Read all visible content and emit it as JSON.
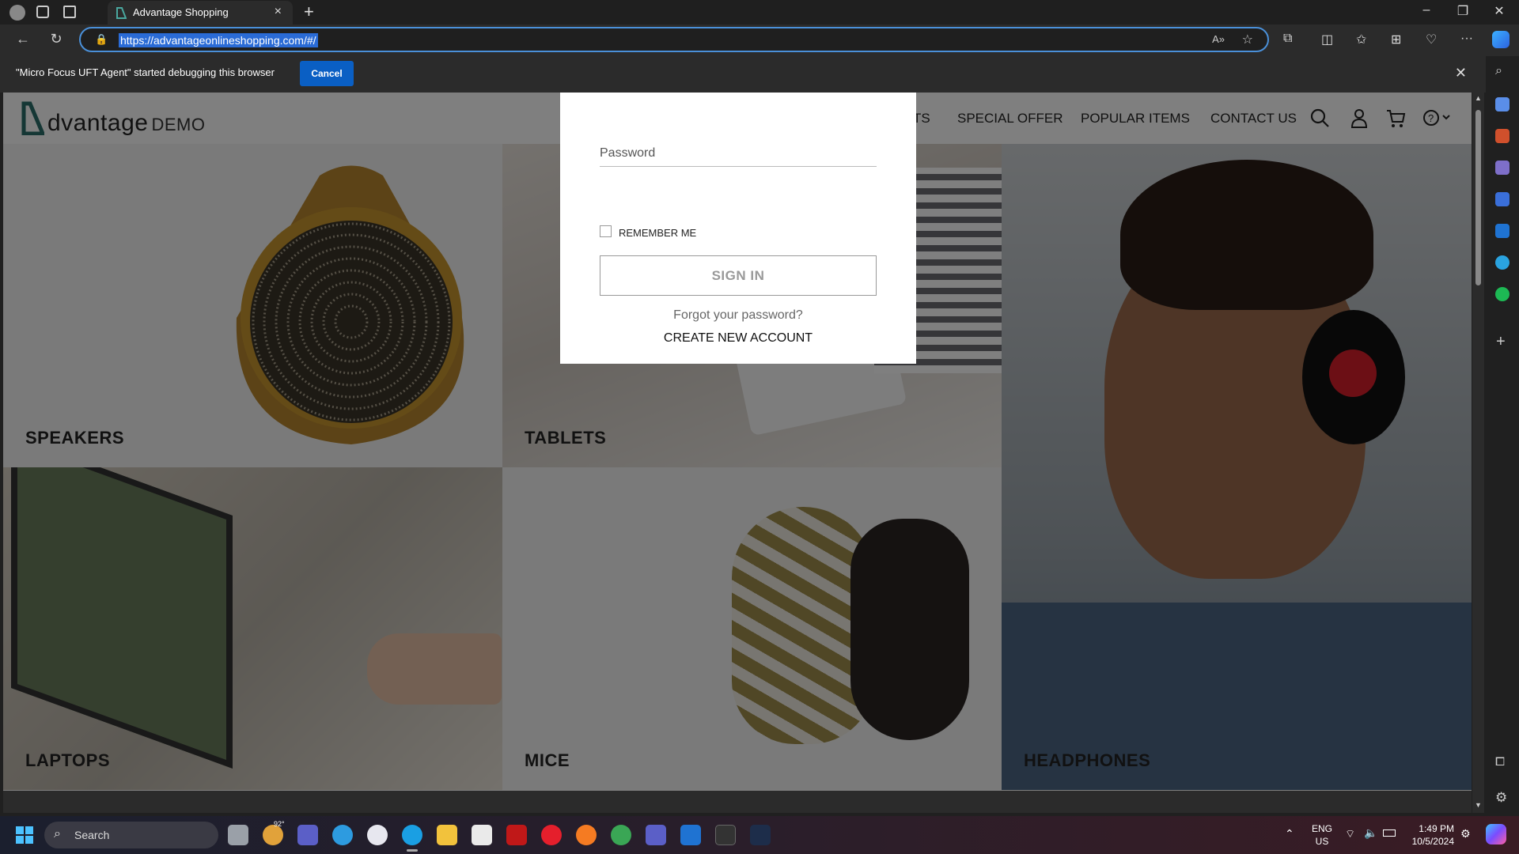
{
  "browser": {
    "tab_title": "Advantage Shopping",
    "tab_close": "×",
    "new_tab": "+",
    "url": "https://advantageonlineshopping.com/#/",
    "window_min": "–",
    "window_restore": "❐",
    "window_close": "✕",
    "more": "···"
  },
  "infobar": {
    "message": "\"Micro Focus UFT Agent\" started debugging this browser",
    "cancel_label": "Cancel",
    "close": "✕"
  },
  "site": {
    "logo_word": "dvantage",
    "logo_demo": "DEMO",
    "nav": {
      "partial": "TS",
      "special_offer": "SPECIAL OFFER",
      "popular_items": "POPULAR ITEMS",
      "contact_us": "CONTACT US"
    },
    "categories": {
      "speakers": "SPEAKERS",
      "tablets": "TABLETS",
      "headphones": "HEADPHONES",
      "laptops": "LAPTOPS",
      "mice": "MICE"
    }
  },
  "login_modal": {
    "password_placeholder": "Password",
    "remember_me": "REMEMBER ME",
    "sign_in": "SIGN IN",
    "forgot_password": "Forgot your password?",
    "create_account": "CREATE NEW ACCOUNT"
  },
  "taskbar": {
    "search_label": "Search",
    "weather_temp": "92°",
    "lang_top": "ENG",
    "lang_bottom": "US",
    "time": "1:49 PM",
    "date": "10/5/2024"
  },
  "colors": {
    "accent": "#0a5fc4",
    "logo_green": "#2b6f6a"
  }
}
